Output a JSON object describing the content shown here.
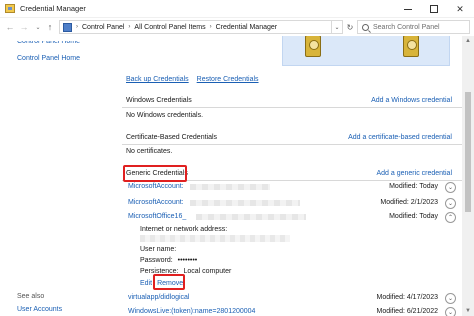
{
  "window": {
    "title": "Credential Manager",
    "controls": {
      "minimize": "minimize",
      "maximize": "maximize",
      "close": "✕"
    }
  },
  "nav": {
    "back": "←",
    "forward": "→",
    "history": "⌄",
    "up": "↑",
    "breadcrumbs": [
      "Control Panel",
      "All Control Panel Items",
      "Credential Manager"
    ],
    "separator": "›",
    "refresh": "↻",
    "search_placeholder": "Search Control Panel"
  },
  "left_pane": {
    "home_link_top": "Control Panel Home",
    "home_link": "Control Panel Home",
    "see_also": "See also",
    "user_accounts": "User Accounts"
  },
  "main": {
    "backup_label": "Back up Credentials",
    "restore_label": "Restore Credentials",
    "sections": {
      "windows": {
        "label": "Windows Credentials",
        "action": "Add a Windows credential",
        "empty": "No Windows credentials."
      },
      "certificate": {
        "label": "Certificate-Based Credentials",
        "action": "Add a certificate-based credential",
        "empty": "No certificates."
      },
      "generic": {
        "label": "Generic Credentials",
        "action": "Add a generic credential"
      }
    },
    "credentials": [
      {
        "name": "MicrosoftAccount:",
        "modified": "Modified:  Today",
        "expanded": false
      },
      {
        "name": "MicrosoftAccount:",
        "modified": "Modified:  2/1/2023",
        "expanded": false
      },
      {
        "name": "MicrosoftOffice16_",
        "modified": "Modified:  Today",
        "expanded": true
      },
      {
        "name": "virtualapp/didlogical",
        "modified": "Modified:  4/17/2023",
        "expanded": false
      },
      {
        "name": "WindowsLive:(token):name=2801200004",
        "modified": "Modified:  6/21/2022",
        "expanded": false
      }
    ],
    "detail": {
      "address_label": "Internet or network address:",
      "username_label": "User name:",
      "password_label": "Password:",
      "password_value": "••••••••",
      "persistence_label": "Persistence:",
      "persistence_value": "Local computer",
      "edit_label": "Edit",
      "remove_label": "Remove"
    }
  },
  "highlight_color": "#e02020",
  "link_color": "#1a5fb4"
}
